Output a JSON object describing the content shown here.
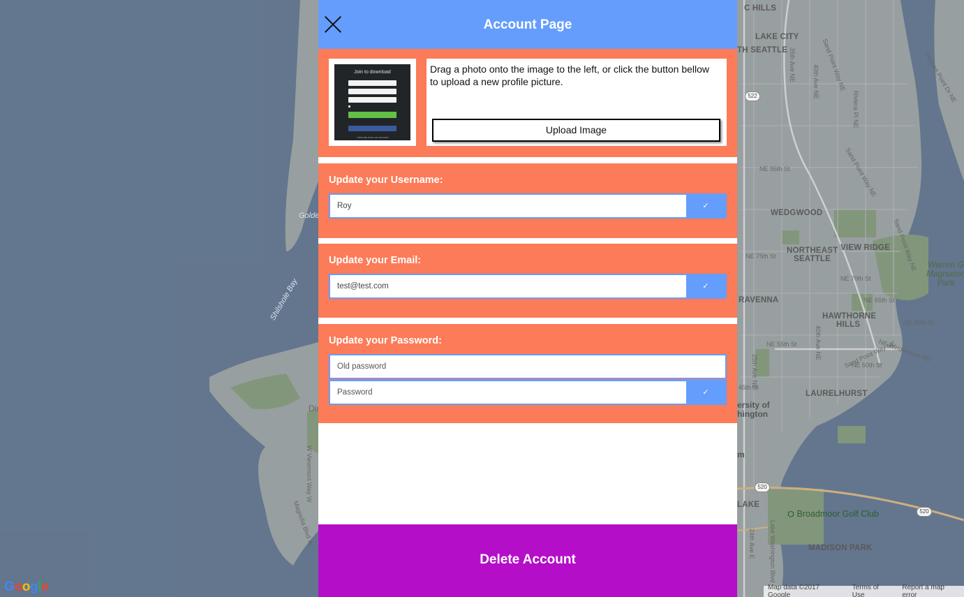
{
  "header": {
    "title": "Account Page",
    "close_icon": "close-icon"
  },
  "photo": {
    "description": "Drag a photo onto the image to the left, or click the button bellow to upload a new profile picture.",
    "upload_label": "Upload Image",
    "thumbnail_title": "Join to download",
    "thumbnail_footer": "I already have an account"
  },
  "username": {
    "label": "Update your Username:",
    "value": "Roy",
    "confirm_icon": "✓"
  },
  "email": {
    "label": "Update your Email:",
    "value": "test@test.com",
    "confirm_icon": "✓"
  },
  "password": {
    "label": "Update your Password:",
    "old_placeholder": "Old password",
    "new_placeholder": "Password",
    "confirm_icon": "✓"
  },
  "delete_label": "Delete Account",
  "map": {
    "logo": "Google",
    "labels": {
      "lake_city": "LAKE CITY",
      "north_seattle": "TH SEATTLE",
      "c_hills": "C HILLS",
      "wedgwood": "WEDGWOOD",
      "northeast_seattle_1": "NORTHEAST",
      "northeast_seattle_2": "SEATTLE",
      "view_ridge": "VIEW RIDGE",
      "ravenna": "RAVENNA",
      "hawthorne_1": "HAWTHORNE",
      "hawthorne_2": "HILLS",
      "laurelhurst": "LAURELHURST",
      "madison_park": "MADISON PARK",
      "lake": "LAKE",
      "warren_1": "Warren G.",
      "warren_2": "Magnuson",
      "warren_3": "Park",
      "broadmoor": "Broadmoor Golf Club",
      "univ_1": "ersity of",
      "univ_2": "hington",
      "m_label": "m",
      "ne95": "NE 95th St",
      "ne75": "NE 75th St",
      "ne70": "NE 70th St",
      "ne65": "NE 65th St",
      "ne60": "NE 60th St",
      "ne55": "NE 55th St",
      "ne50": "NE 50th St",
      "st45": "45th St",
      "ave35": "35th Ave NE",
      "ave40": "40th Ave NE",
      "ave40b": "40th Ave NE",
      "ave25": "25th Ave NE",
      "ave24": "24th Ave E",
      "sandpoint1": "Sand Point Way NE",
      "sandpoint2": "Sand Point Way NE",
      "sandpoint3": "Sand Point Way NE",
      "sandpoint4": "Sand Point Way NE",
      "riviera": "Riviera Pl NE",
      "holmes": "Holmes Point Dr NE",
      "windermere": "NE Windermere Rd",
      "lakewash": "Lake Washington Blvd",
      "shilshole": "Shilshole Bay",
      "golden": "Golde",
      "dis": "Dis",
      "viewmont": "W Viewmont Way W",
      "magnolia": "Magnolia Blvd W",
      "nav": "NE",
      "hwy522": "522",
      "hwy520a": "520",
      "hwy520b": "520"
    },
    "footer": {
      "data": "Map data ©2017 Google",
      "terms": "Terms of Use",
      "report": "Report a map error"
    }
  }
}
